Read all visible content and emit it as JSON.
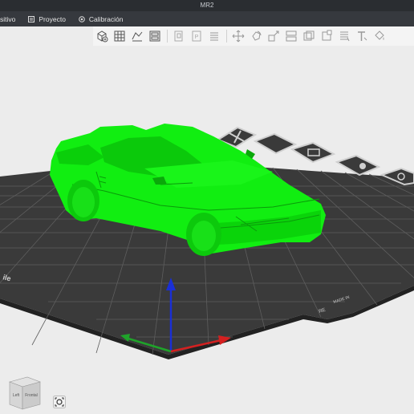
{
  "window": {
    "title": "MR2"
  },
  "menu": {
    "items": [
      {
        "label": "sitivo",
        "icon": "device-icon"
      },
      {
        "label": "Proyecto",
        "icon": "project-icon"
      },
      {
        "label": "Calibración",
        "icon": "calibration-icon"
      }
    ]
  },
  "toolbar": {
    "buttons": [
      "add-object-icon",
      "arrange-grid-icon",
      "import-icon",
      "layout-icon",
      "copy-icon",
      "paste-icon",
      "list-icon",
      "move-icon",
      "rotate-icon",
      "scale-icon",
      "split-icon",
      "cut-icon",
      "support-icon",
      "variable-layer-icon",
      "text-icon",
      "paint-icon"
    ]
  },
  "viewport": {
    "model": "car-model",
    "bed_labels": [
      "RE",
      "MADE IN"
    ],
    "axes": {
      "x": "#d42020",
      "y": "#1fa32a",
      "z": "#1a2fd6"
    }
  },
  "view_cube": {
    "top": "",
    "left": "Left",
    "front": "Frontal"
  },
  "colors": {
    "model": "#11ee11",
    "bed": "#3a3a3a",
    "grid": "#606060"
  }
}
